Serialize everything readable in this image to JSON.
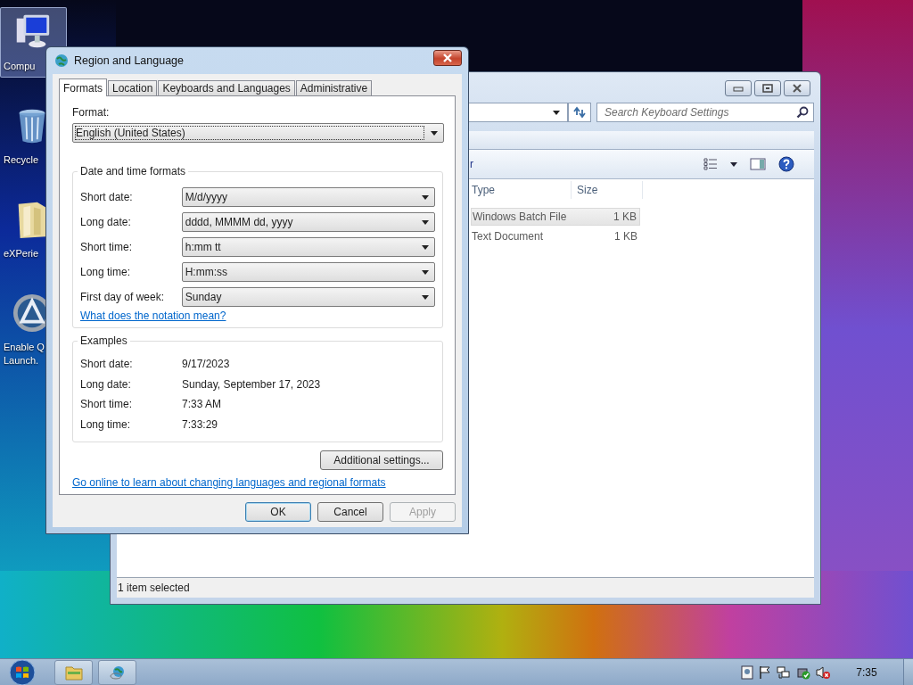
{
  "desktop": {
    "icons": [
      {
        "kind": "computer",
        "lines": [
          "Compu"
        ],
        "selected": true
      },
      {
        "kind": "recycle",
        "lines": [
          "Recycle"
        ],
        "selected": false
      },
      {
        "kind": "folder",
        "lines": [
          "eXPerie"
        ],
        "selected": false
      },
      {
        "kind": "launch",
        "lines": [
          "Enable Q",
          "Launch."
        ],
        "selected": false
      }
    ]
  },
  "explorer": {
    "search": {
      "placeholder": "Search Keyboard Settings"
    },
    "toolbar_text": "r",
    "columns": [
      "Type",
      "Size"
    ],
    "rows": [
      {
        "type": "Windows Batch File",
        "size": "1 KB",
        "selected": true
      },
      {
        "type": "Text Document",
        "size": "1 KB",
        "selected": false
      }
    ],
    "status": "1 item selected"
  },
  "dialog": {
    "title": "Region and Language",
    "tabs": [
      {
        "label": "Formats",
        "selected": true
      },
      {
        "label": "Location",
        "selected": false
      },
      {
        "label": "Keyboards and Languages",
        "selected": false
      },
      {
        "label": "Administrative",
        "selected": false
      }
    ],
    "format": {
      "label": "Format:",
      "value": "English (United States)"
    },
    "date_time": {
      "title": "Date and time formats",
      "fields": [
        {
          "label": "Short date:",
          "value": "M/d/yyyy"
        },
        {
          "label": "Long date:",
          "value": "dddd, MMMM dd, yyyy"
        },
        {
          "label": "Short time:",
          "value": "h:mm tt"
        },
        {
          "label": "Long time:",
          "value": "H:mm:ss"
        },
        {
          "label": "First day of week:",
          "value": "Sunday"
        }
      ],
      "link": "What does the notation mean?"
    },
    "examples": {
      "title": "Examples",
      "rows": [
        {
          "label": "Short date:",
          "value": "9/17/2023"
        },
        {
          "label": "Long date:",
          "value": "Sunday, September 17, 2023"
        },
        {
          "label": "Short time:",
          "value": "7:33 AM"
        },
        {
          "label": "Long time:",
          "value": "7:33:29"
        }
      ]
    },
    "additional_button": "Additional settings...",
    "online_link": "Go online to learn about changing languages and regional formats",
    "buttons": [
      {
        "label": "OK",
        "default": true,
        "disabled": false
      },
      {
        "label": "Cancel",
        "default": false,
        "disabled": false
      },
      {
        "label": "Apply",
        "default": false,
        "disabled": true
      }
    ]
  },
  "taskbar": {
    "clock": "7:35"
  }
}
